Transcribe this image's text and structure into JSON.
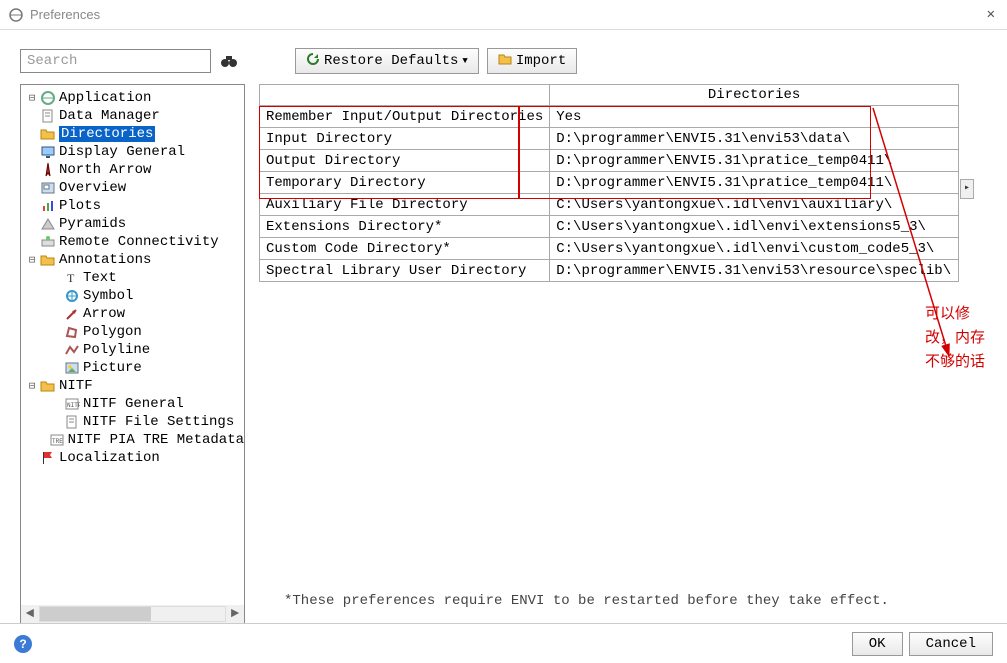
{
  "window": {
    "title": "Preferences"
  },
  "toolbar": {
    "search_placeholder": "Search",
    "restore_label": "Restore Defaults",
    "import_label": "Import"
  },
  "tree": {
    "items": [
      {
        "label": "Application",
        "icon": "app",
        "indent": 1
      },
      {
        "label": "Data Manager",
        "icon": "doc",
        "indent": 1
      },
      {
        "label": "Directories",
        "icon": "folder-open",
        "indent": 1,
        "selected": true
      },
      {
        "label": "Display General",
        "icon": "monitor",
        "indent": 1
      },
      {
        "label": "North Arrow",
        "icon": "compass",
        "indent": 1
      },
      {
        "label": "Overview",
        "icon": "overview",
        "indent": 1
      },
      {
        "label": "Plots",
        "icon": "chart",
        "indent": 1
      },
      {
        "label": "Pyramids",
        "icon": "pyramid",
        "indent": 1
      },
      {
        "label": "Remote Connectivity",
        "icon": "remote",
        "indent": 1
      },
      {
        "label": "Annotations",
        "icon": "folder-open",
        "indent": 1,
        "twisty": "minus"
      },
      {
        "label": "Text",
        "icon": "text",
        "indent": 2
      },
      {
        "label": "Symbol",
        "icon": "symbol",
        "indent": 2
      },
      {
        "label": "Arrow",
        "icon": "arrowtool",
        "indent": 2
      },
      {
        "label": "Polygon",
        "icon": "polygon",
        "indent": 2
      },
      {
        "label": "Polyline",
        "icon": "polyline",
        "indent": 2
      },
      {
        "label": "Picture",
        "icon": "picture",
        "indent": 2
      },
      {
        "label": "NITF",
        "icon": "folder-open",
        "indent": 1,
        "twisty": "minus"
      },
      {
        "label": "NITF General",
        "icon": "nitf",
        "indent": 2
      },
      {
        "label": "NITF File Settings",
        "icon": "doc",
        "indent": 2
      },
      {
        "label": "NITF PIA TRE Metadata",
        "icon": "tre",
        "indent": 2
      },
      {
        "label": "Localization",
        "icon": "flag",
        "indent": 1
      }
    ]
  },
  "grid": {
    "header": "Directories",
    "rows": [
      {
        "label": "Remember Input/Output Directories",
        "value": "Yes"
      },
      {
        "label": "Input Directory",
        "value": "D:\\programmer\\ENVI5.31\\envi53\\data\\"
      },
      {
        "label": "Output Directory",
        "value": "D:\\programmer\\ENVI5.31\\pratice_temp0411\\"
      },
      {
        "label": "Temporary Directory",
        "value": "D:\\programmer\\ENVI5.31\\pratice_temp0411\\"
      },
      {
        "label": "Auxiliary File Directory",
        "value": "C:\\Users\\yantongxue\\.idl\\envi\\auxiliary\\"
      },
      {
        "label": "Extensions Directory*",
        "value": "C:\\Users\\yantongxue\\.idl\\envi\\extensions5_3\\"
      },
      {
        "label": "Custom Code Directory*",
        "value": "C:\\Users\\yantongxue\\.idl\\envi\\custom_code5_3\\"
      },
      {
        "label": "Spectral Library User Directory",
        "value": "D:\\programmer\\ENVI5.31\\envi53\\resource\\speclib\\"
      }
    ]
  },
  "annotation": {
    "text": "可以修改，内存不够的话"
  },
  "footnote": "*These preferences require ENVI to be restarted before they take effect.",
  "buttons": {
    "ok": "OK",
    "cancel": "Cancel"
  }
}
